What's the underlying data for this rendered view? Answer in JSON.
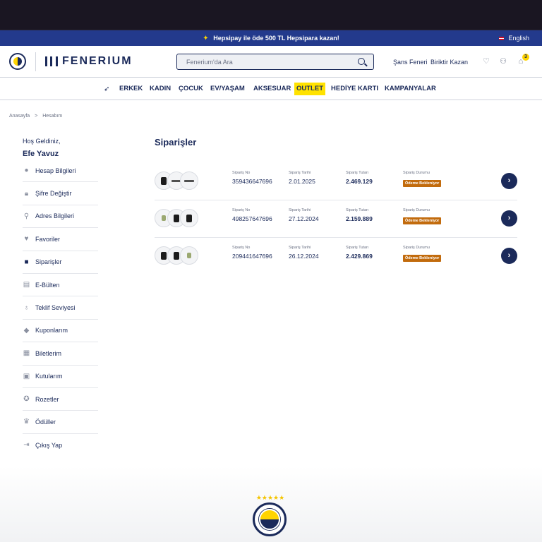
{
  "promo": {
    "text": "Hepsipay ile öde 500 TL Hepsipara kazan!",
    "language": "English"
  },
  "header": {
    "brand": "FENERIUM",
    "search_placeholder": "Fenerium'da Ara",
    "links": [
      "Şans Feneri",
      "Biriktir Kazan"
    ],
    "cart_count": "3"
  },
  "nav": {
    "items": [
      "ERKEK",
      "KADIN",
      "ÇOCUK",
      "EV/YAŞAM",
      "AKSESUAR",
      "OUTLET",
      "HEDİYE KARTI",
      "KAMPANYALAR"
    ]
  },
  "breadcrumb": {
    "home": "Anasayfa",
    "separator": ">",
    "current": "Hesabım"
  },
  "sidebar": {
    "welcome": "Hoş Geldiniz,",
    "username": "Efe Yavuz",
    "items": [
      {
        "label": "Hesap Bilgileri",
        "icon": "user-icon"
      },
      {
        "label": "Şifre Değiştir",
        "icon": "lock-icon"
      },
      {
        "label": "Adres Bilgileri",
        "icon": "location-pin-icon"
      },
      {
        "label": "Favoriler",
        "icon": "heart-icon"
      },
      {
        "label": "Siparişler",
        "icon": "box-icon"
      },
      {
        "label": "E-Bülten",
        "icon": "newsletter-icon"
      },
      {
        "label": "Teklif Seviyesi",
        "icon": "lightbulb-icon"
      },
      {
        "label": "Kuponlarım",
        "icon": "tag-icon"
      },
      {
        "label": "Biletlerim",
        "icon": "ticket-icon"
      },
      {
        "label": "Kutularım",
        "icon": "gift-box-icon"
      },
      {
        "label": "Rozetler",
        "icon": "badge-icon"
      },
      {
        "label": "Ödüller",
        "icon": "trophy-icon"
      },
      {
        "label": "Çıkış Yap",
        "icon": "logout-icon"
      }
    ]
  },
  "orders": {
    "title": "Siparişler",
    "labels": {
      "order_no": "Sipariş No",
      "order_date": "Sipariş Tarihi",
      "order_total": "Sipariş Tutarı",
      "order_status": "Sipariş Durumu"
    },
    "rows": [
      {
        "order_no": "359436647696",
        "date": "2.01.2025",
        "total": "2.469.129",
        "status": "Ödeme Bekleniyor",
        "thumbs": [
          "black",
          "flat",
          "flat"
        ]
      },
      {
        "order_no": "498257647696",
        "date": "27.12.2024",
        "total": "2.159.889",
        "status": "Ödeme Bekleniyor",
        "thumbs": [
          "green",
          "black",
          "black"
        ]
      },
      {
        "order_no": "209441647696",
        "date": "26.12.2024",
        "total": "2.429.869",
        "status": "Ödeme Bekleniyor",
        "thumbs": [
          "black",
          "black",
          "green"
        ]
      }
    ]
  },
  "footer": {
    "stars": "★★★★★"
  },
  "colors": {
    "primary": "#1b2a5a",
    "promo_bg": "#233a8c",
    "accent_yellow": "#ffe200",
    "status_bg": "#c26b0d"
  }
}
